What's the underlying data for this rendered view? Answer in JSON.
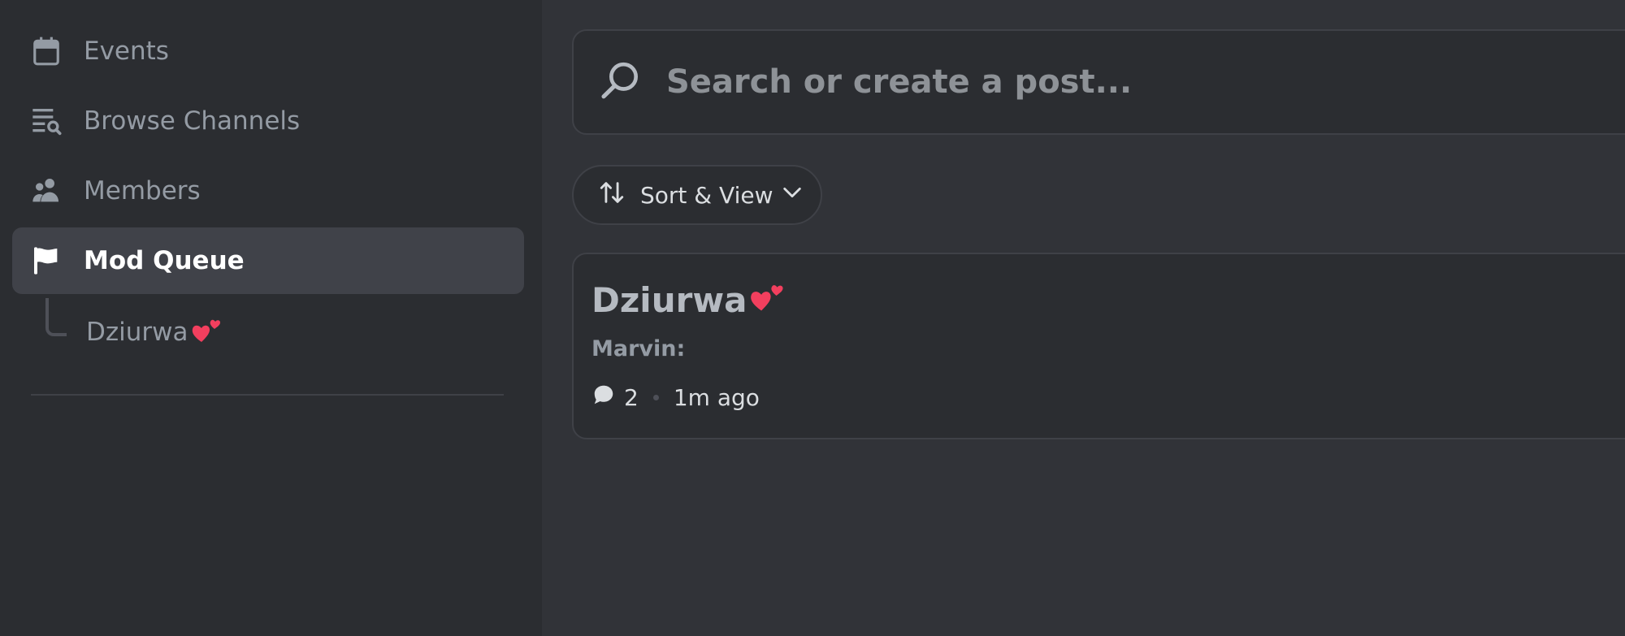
{
  "sidebar": {
    "items": [
      {
        "label": "Events",
        "icon": "calendar-icon"
      },
      {
        "label": "Browse Channels",
        "icon": "browse-channels-icon"
      },
      {
        "label": "Members",
        "icon": "members-icon"
      },
      {
        "label": "Mod Queue",
        "icon": "flag-icon",
        "active": true
      }
    ],
    "thread": {
      "label": "Dziurwa",
      "emoji": "two-hearts-icon"
    }
  },
  "search": {
    "placeholder": "Search or create a post..."
  },
  "sort_view": {
    "label": "Sort & View"
  },
  "post": {
    "title": "Dziurwa",
    "author": "Marvin:",
    "comment_count": "2",
    "time": "1m ago"
  },
  "colors": {
    "sidebar_bg": "#2b2d31",
    "main_bg": "#313338",
    "active_bg": "#404249",
    "heart": "#f23f5e"
  }
}
